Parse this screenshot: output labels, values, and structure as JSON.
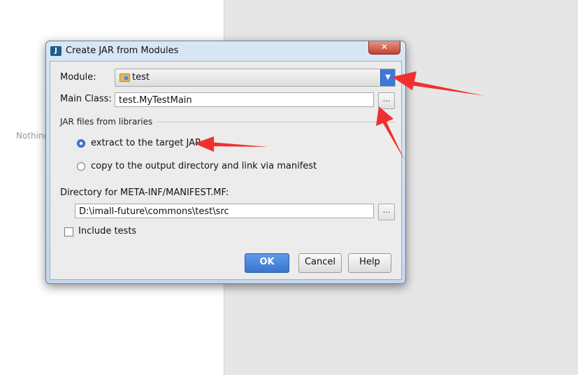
{
  "background": {
    "nothing_text": "Nothing"
  },
  "dialog": {
    "title": "Create JAR from Modules",
    "app_icon": "intellij-icon",
    "close_symbol": "x",
    "module": {
      "label": "Module:",
      "value": "test"
    },
    "main_class": {
      "label": "Main Class:",
      "value": "test.MyTestMain",
      "browse": "..."
    },
    "jar_files": {
      "section_label": "JAR files from libraries",
      "options": [
        {
          "label": "extract to the target JAR",
          "selected": true
        },
        {
          "label": "copy to the output directory and link via manifest",
          "selected": false
        }
      ]
    },
    "manifest": {
      "label": "Directory for META-INF/MANIFEST.MF:",
      "value": "D:\\imall-future\\commons\\test\\src",
      "browse": "..."
    },
    "include_tests": {
      "label": "Include tests",
      "checked": false
    },
    "buttons": {
      "ok": "OK",
      "cancel": "Cancel",
      "help": "Help"
    }
  },
  "colors": {
    "annotation_arrow": "#f03030",
    "primary_button": "#3a75cf"
  }
}
